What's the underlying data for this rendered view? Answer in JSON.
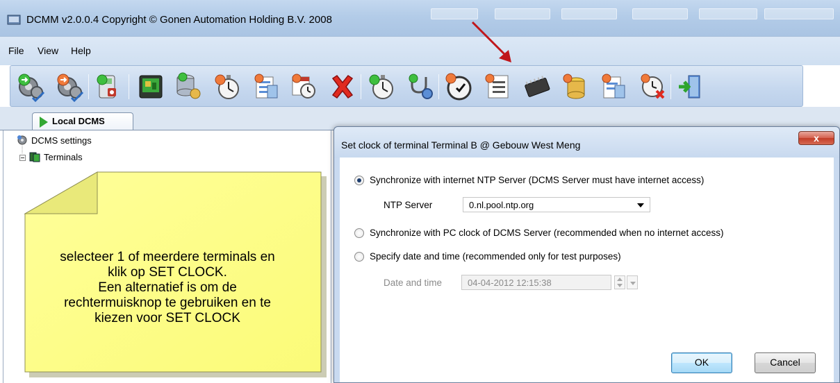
{
  "window": {
    "title": "DCMM v2.0.0.4 Copyright © Gonen Automation Holding B.V. 2008"
  },
  "menu": {
    "items": [
      "File",
      "View",
      "Help"
    ]
  },
  "toolbar": {
    "buttons": [
      "start-services-icon",
      "stop-services-icon",
      "terminal-security-icon",
      "terminal-board-icon",
      "database-server-icon",
      "stopwatch-icon",
      "schedule-report-icon",
      "calendar-clock-icon",
      "delete-icon",
      "stopwatch-refresh-icon",
      "stethoscope-icon",
      "set-clock-icon",
      "task-list-icon",
      "chip-icon",
      "database-upload-icon",
      "report-upload-icon",
      "clock-cancel-icon",
      "exit-icon"
    ]
  },
  "tabs": {
    "active": "Local DCMS"
  },
  "tree": {
    "items": [
      "DCMS settings",
      "Terminals"
    ]
  },
  "note": {
    "text": "selecteer 1 of meerdere terminals en\nklik op SET CLOCK.\nEen alternatief is om de\nrechtermuisknop te gebruiken en te\nkiezen voor SET CLOCK"
  },
  "dialog": {
    "title": "Set clock of terminal Terminal B @ Gebouw West Meng",
    "close_label": "x",
    "option_ntp": "Synchronize with internet NTP Server (DCMS Server must have internet access)",
    "ntp_label": "NTP Server",
    "ntp_value": "0.nl.pool.ntp.org",
    "option_pc": "Synchronize with PC clock of DCMS Server (recommended when no internet access)",
    "option_manual": "Specify date and time (recommended only for test purposes)",
    "datetime_label": "Date and time",
    "datetime_value": "04-04-2012 12:15:38",
    "ok_label": "OK",
    "cancel_label": "Cancel"
  },
  "colors": {
    "note_fill": "#ffff88",
    "annotation_arrow": "#c0161b",
    "accent": "#34a834"
  }
}
